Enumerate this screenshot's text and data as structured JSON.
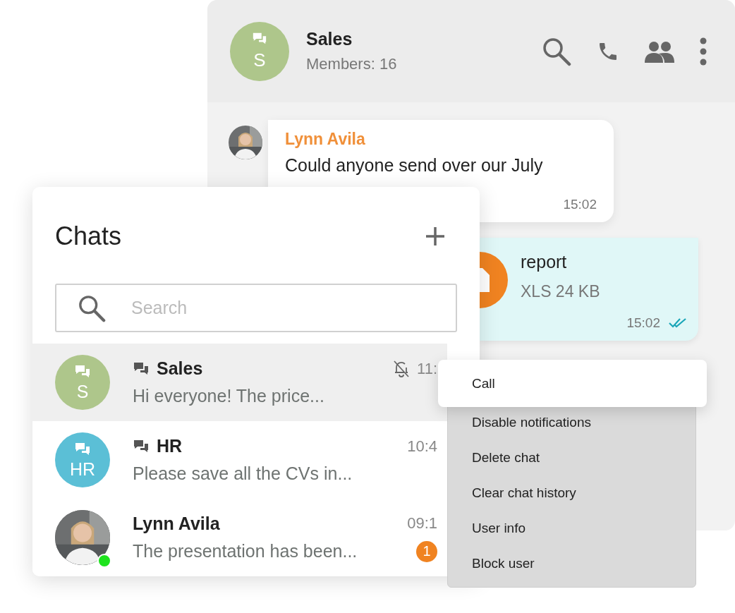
{
  "conversation": {
    "title": "Sales",
    "avatar": "S",
    "subtitle": "Members: 16",
    "messages": [
      {
        "kind": "text",
        "sender": "Lynn Avila",
        "text": "Could anyone send over our July",
        "time": "15:02"
      },
      {
        "kind": "file",
        "name": "report",
        "meta": "XLS 24 KB",
        "time": "15:02",
        "read": true
      }
    ]
  },
  "chats": {
    "title": "Chats",
    "search": {
      "placeholder": "Search"
    },
    "items": [
      {
        "kind": "group",
        "name": "Sales",
        "preview": "Hi everyone! The price...",
        "time": "11:",
        "avatar": "S",
        "color": "#aec68b",
        "muted": true,
        "selected": true
      },
      {
        "kind": "group",
        "name": "HR",
        "preview": "Please save all the CVs in...",
        "time": "10:4",
        "avatar": "HR",
        "color": "#5bbfd6",
        "muted": false,
        "selected": false
      },
      {
        "kind": "person",
        "name": "Lynn Avila",
        "preview": "The presentation has been...",
        "time": "09:1",
        "unread": "1",
        "online": true,
        "muted": false,
        "selected": false
      }
    ]
  },
  "menu": {
    "items": [
      {
        "label": "Call",
        "selected": true
      },
      {
        "label": "Disable notifications",
        "selected": false
      },
      {
        "label": "Delete chat",
        "selected": false
      },
      {
        "label": "Clear chat history",
        "selected": false
      },
      {
        "label": "User info",
        "selected": false
      },
      {
        "label": "Block user",
        "selected": false
      }
    ]
  }
}
